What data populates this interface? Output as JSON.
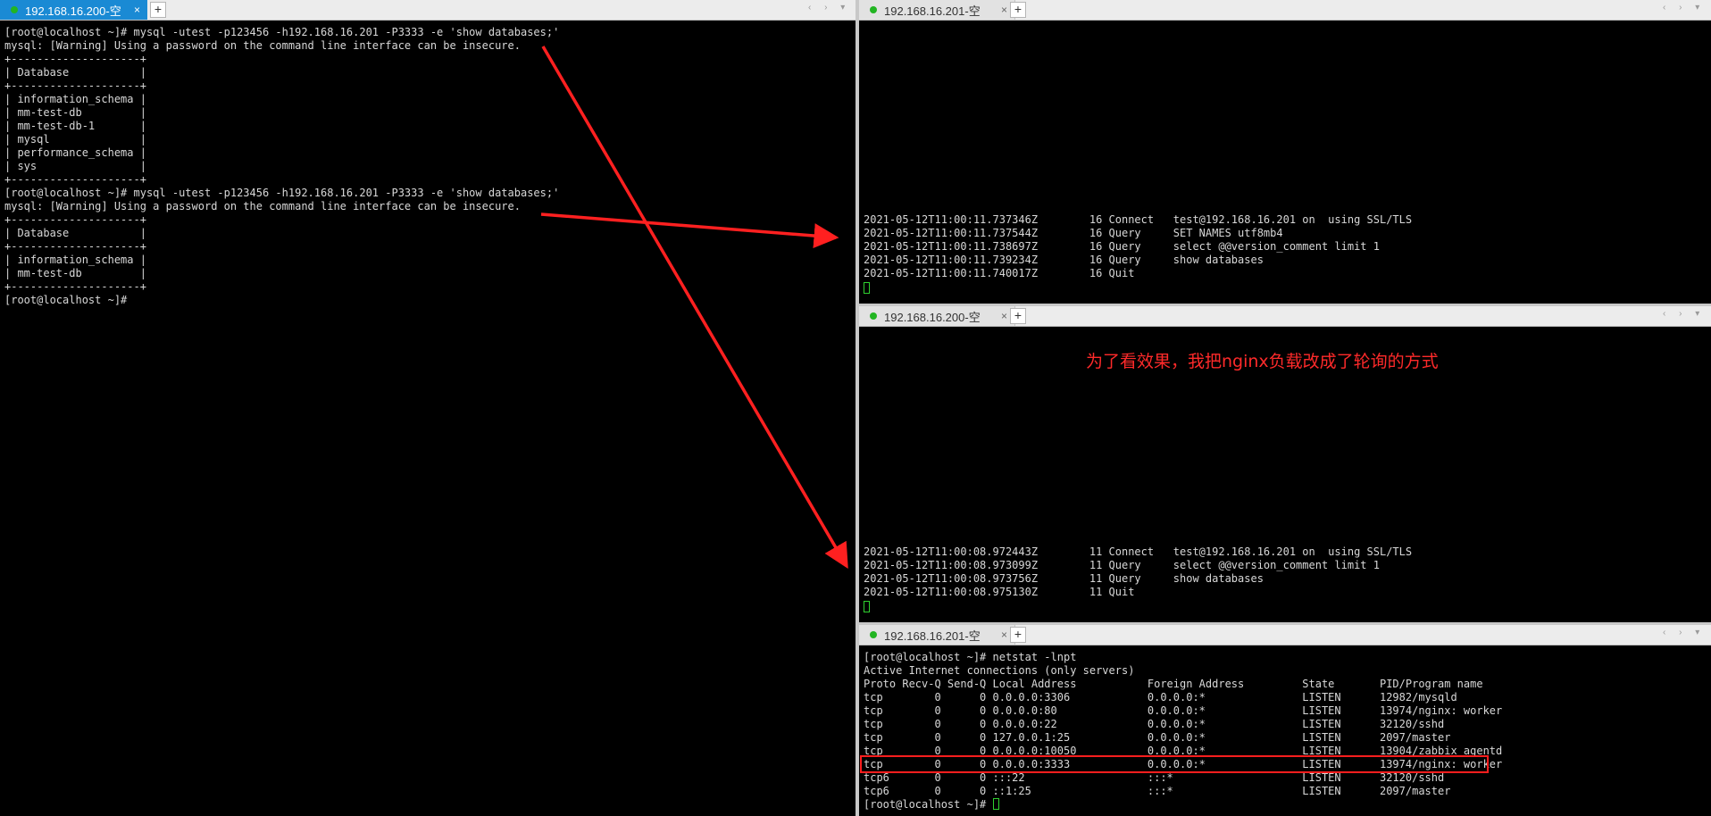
{
  "left_pane": {
    "tab_label": "192.168.16.200-空",
    "tab_close": "×",
    "add_tab": "+",
    "nav": "‹ › ▾",
    "lines": [
      "[root@localhost ~]# mysql -utest -p123456 -h192.168.16.201 -P3333 -e 'show databases;'",
      "mysql: [Warning] Using a password on the command line interface can be insecure.",
      "+--------------------+",
      "| Database           |",
      "+--------------------+",
      "| information_schema |",
      "| mm-test-db         |",
      "| mm-test-db-1       |",
      "| mysql              |",
      "| performance_schema |",
      "| sys                |",
      "+--------------------+",
      "[root@localhost ~]# mysql -utest -p123456 -h192.168.16.201 -P3333 -e 'show databases;'",
      "mysql: [Warning] Using a password on the command line interface can be insecure.",
      "+--------------------+",
      "| Database           |",
      "+--------------------+",
      "| information_schema |",
      "| mm-test-db         |",
      "+--------------------+",
      "[root@localhost ~]#"
    ]
  },
  "top_right_pane": {
    "tab_label": "192.168.16.201-空",
    "tab_close": "×",
    "add_tab": "+",
    "nav": "‹ › ▾",
    "lines": [
      "2021-05-12T11:00:11.737346Z        16 Connect   test@192.168.16.201 on  using SSL/TLS",
      "2021-05-12T11:00:11.737544Z        16 Query     SET NAMES utf8mb4",
      "2021-05-12T11:00:11.738697Z        16 Query     select @@version_comment limit 1",
      "2021-05-12T11:00:11.739234Z        16 Query     show databases",
      "2021-05-12T11:00:11.740017Z        16 Quit"
    ]
  },
  "middle_right_pane": {
    "tab_label": "192.168.16.200-空",
    "tab_close": "×",
    "add_tab": "+",
    "nav": "‹ › ▾",
    "annotation": "为了看效果，我把nginx负载改成了轮询的方式",
    "lines": [
      "2021-05-12T11:00:08.972443Z        11 Connect   test@192.168.16.201 on  using SSL/TLS",
      "2021-05-12T11:00:08.973099Z        11 Query     select @@version_comment limit 1",
      "2021-05-12T11:00:08.973756Z        11 Query     show databases",
      "2021-05-12T11:00:08.975130Z        11 Quit"
    ]
  },
  "bottom_right_pane": {
    "tab_label": "192.168.16.201-空",
    "tab_close": "×",
    "add_tab": "+",
    "nav": "‹ › ▾",
    "lines_before": [
      "[root@localhost ~]# netstat -lnpt",
      "Active Internet connections (only servers)",
      "Proto Recv-Q Send-Q Local Address           Foreign Address         State       PID/Program name",
      "tcp        0      0 0.0.0.0:3306            0.0.0.0:*               LISTEN      12982/mysqld",
      "tcp        0      0 0.0.0.0:80              0.0.0.0:*               LISTEN      13974/nginx: worker",
      "tcp        0      0 0.0.0.0:22              0.0.0.0:*               LISTEN      32120/sshd",
      "tcp        0      0 127.0.0.1:25            0.0.0.0:*               LISTEN      2097/master",
      "tcp        0      0 0.0.0.0:10050           0.0.0.0:*               LISTEN      13904/zabbix_agentd"
    ],
    "highlighted_line": "tcp        0      0 0.0.0.0:3333            0.0.0.0:*               LISTEN      13974/nginx: worker",
    "lines_after": [
      "tcp6       0      0 :::22                   :::*                    LISTEN      32120/sshd",
      "tcp6       0      0 ::1:25                  :::*                    LISTEN      2097/master"
    ],
    "prompt": "[root@localhost ~]# "
  },
  "colors": {
    "terminal_bg": "#000000",
    "terminal_text": "#d8d8d8",
    "active_tab": "#1a8ad4",
    "status_dot": "#22b522",
    "annotation_red": "#ff2a2a",
    "cursor_green": "#2fd12f"
  }
}
